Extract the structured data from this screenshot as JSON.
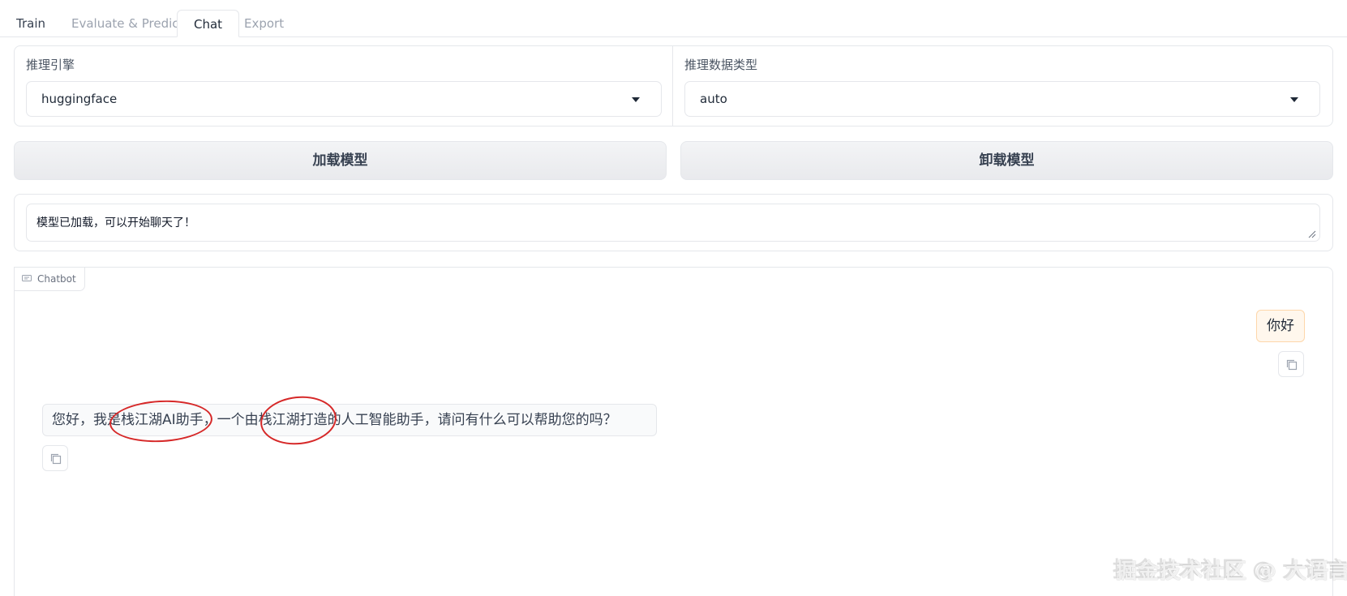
{
  "tabs": [
    {
      "label": "Train"
    },
    {
      "label": "Evaluate & Predict"
    },
    {
      "label": "Chat"
    },
    {
      "label": "Export"
    }
  ],
  "active_tab": "Chat",
  "settings": {
    "engine_label": "推理引擎",
    "engine_value": "huggingface",
    "dtype_label": "推理数据类型",
    "dtype_value": "auto"
  },
  "buttons": {
    "load": "加载模型",
    "unload": "卸载模型"
  },
  "status": {
    "value": "模型已加载，可以开始聊天了！"
  },
  "chatbot": {
    "label": "Chatbot",
    "messages": [
      {
        "role": "user",
        "text": "你好"
      },
      {
        "role": "assistant",
        "text": "您好，我是栈江湖AI助手，一个由栈江湖打造的人工智能助手，请问有什么可以帮助您的吗？"
      }
    ]
  },
  "watermark": "掘金技术社区 @ 大语言模型",
  "colors": {
    "annotation": "#d62828",
    "user_bubble": "#fff7ed",
    "bot_bubble": "#f9fafb"
  },
  "icons": [
    "chat-icon",
    "copy-icon",
    "chevron-down-icon",
    "resize-handle-icon"
  ]
}
